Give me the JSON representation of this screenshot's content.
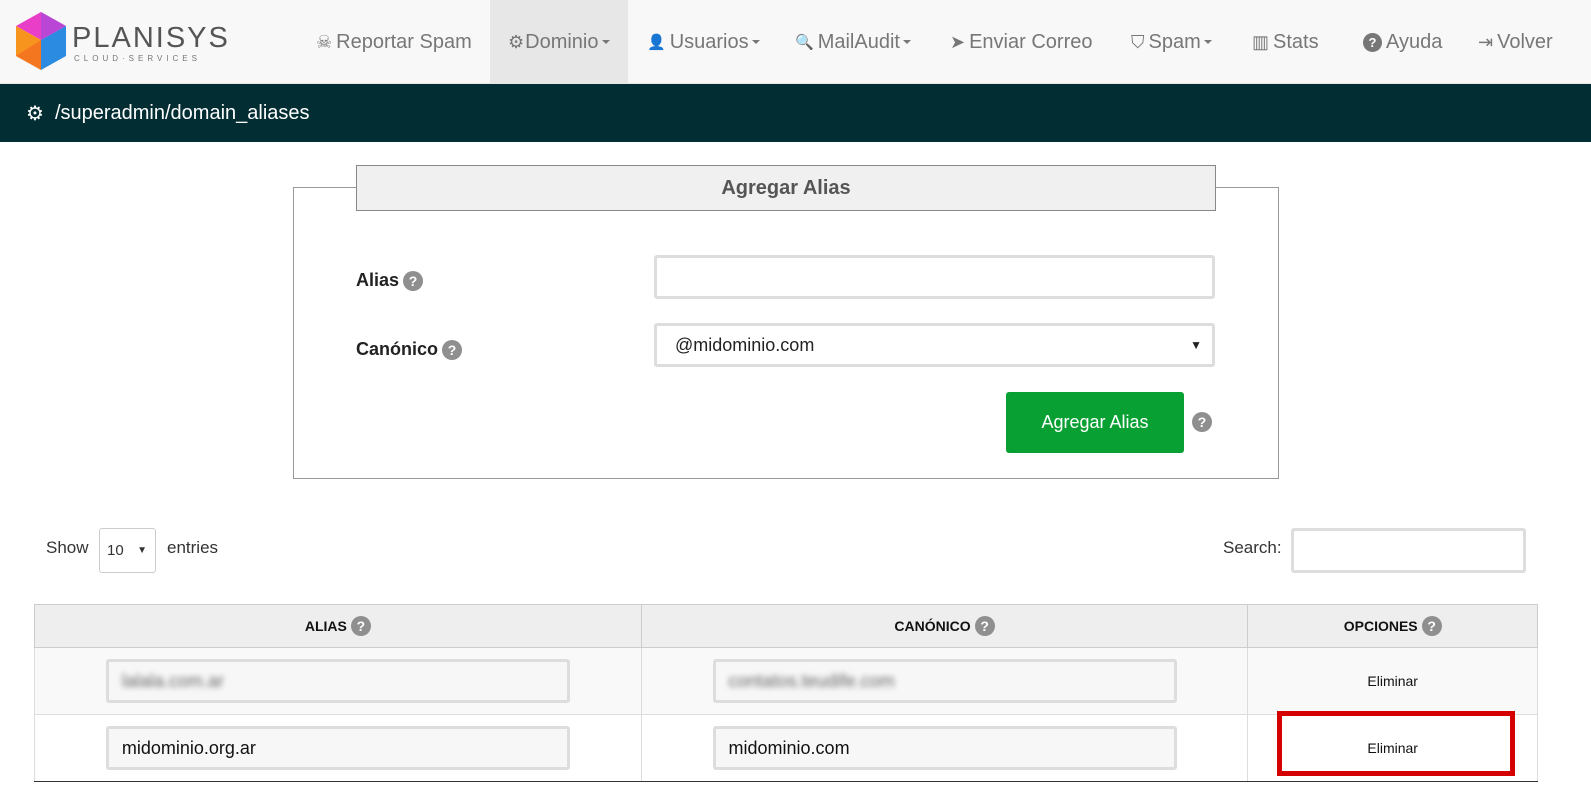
{
  "brand": {
    "name": "PLANISYS",
    "tagline": "CLOUD·SERVICES"
  },
  "nav": [
    {
      "label": "Reportar Spam",
      "icon": "skull-crossbones-icon",
      "glyph": "☠",
      "dropdown": false,
      "active": false
    },
    {
      "label": "Dominio",
      "icon": "gear-icon",
      "glyph": "⚙",
      "dropdown": true,
      "active": true
    },
    {
      "label": "Usuarios",
      "icon": "user-icon",
      "glyph": "👤",
      "dropdown": true,
      "active": false
    },
    {
      "label": "MailAudit",
      "icon": "search-icon",
      "glyph": "🔍",
      "dropdown": true,
      "active": false
    },
    {
      "label": "Enviar Correo",
      "icon": "paper-plane-icon",
      "glyph": "➤",
      "dropdown": false,
      "active": false
    },
    {
      "label": "Spam",
      "icon": "shield-icon",
      "glyph": "⛉",
      "dropdown": true,
      "active": false
    },
    {
      "label": "Stats",
      "icon": "bar-chart-icon",
      "glyph": "▥",
      "dropdown": false,
      "active": false
    },
    {
      "label": "Ayuda",
      "icon": "question-circle-icon",
      "glyph": "?",
      "dropdown": false,
      "active": false
    },
    {
      "label": "Volver",
      "icon": "sign-in-icon",
      "glyph": "⇥",
      "dropdown": false,
      "active": false
    }
  ],
  "path": {
    "icon": "gear-icon",
    "text": "/superadmin/domain_aliases"
  },
  "form": {
    "title": "Agregar Alias",
    "alias_label": "Alias",
    "alias_value": "",
    "canonico_label": "Canónico",
    "canonico_value": "@midominio.com",
    "submit_label": "Agregar Alias",
    "help_glyph": "?"
  },
  "table_controls": {
    "show_label": "Show",
    "page_length": "10",
    "entries_label": "entries",
    "search_label": "Search:",
    "search_value": ""
  },
  "table": {
    "headers": [
      "ALIAS",
      "CANÓNICO",
      "OPCIONES"
    ],
    "rows": [
      {
        "alias": "lalala.com.ar",
        "canonico": "contatos.teudife.com",
        "option": "Eliminar",
        "blurred": true
      },
      {
        "alias": "midominio.org.ar",
        "canonico": "midominio.com",
        "option": "Eliminar",
        "blurred": false
      }
    ]
  },
  "colors": {
    "nav_bg": "#f8f8f8",
    "path_bar_bg": "#022d33",
    "submit_bg": "#08a033",
    "highlight_border": "#d50000"
  }
}
